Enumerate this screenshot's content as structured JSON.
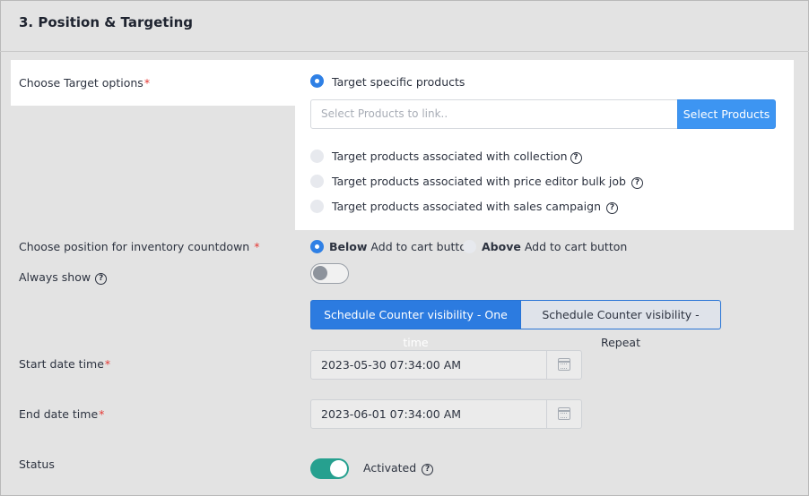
{
  "section": {
    "title": "3. Position & Targeting"
  },
  "target": {
    "label": "Choose Target options",
    "required": "*",
    "options": [
      {
        "label": "Target specific products",
        "selected": true,
        "help": false
      },
      {
        "label": "Target products associated with collection",
        "selected": false,
        "help": true
      },
      {
        "label": "Target products associated with price editor bulk job",
        "selected": false,
        "help": true
      },
      {
        "label": "Target products associated with sales campaign",
        "selected": false,
        "help": true
      }
    ],
    "products_placeholder": "Select Products to link..",
    "select_button": "Select Products"
  },
  "position": {
    "label": "Choose position for inventory countdown",
    "required": "*",
    "below_bold": "Below",
    "below_text": "Add to cart button",
    "above_bold": "Above",
    "above_text": "Add to cart button",
    "selected": "below"
  },
  "always_show": {
    "label": "Always show",
    "enabled": false
  },
  "schedule": {
    "one_time": "Schedule Counter visibility - One time",
    "repeat": "Schedule Counter visibility - Repeat",
    "active": "one_time"
  },
  "start": {
    "label": "Start date time",
    "required": "*",
    "value": "2023-05-30 07:34:00 AM"
  },
  "end": {
    "label": "End date time",
    "required": "*",
    "value": "2023-06-01 07:34:00 AM"
  },
  "status": {
    "label": "Status",
    "value": "Activated",
    "enabled": true
  },
  "icons": {
    "help": "question-circle-icon",
    "calendar": "calendar-icon"
  },
  "colors": {
    "primary": "#2c7be0",
    "button": "#3d95f2",
    "toggle_on": "#26a08f",
    "required": "#e53935"
  }
}
